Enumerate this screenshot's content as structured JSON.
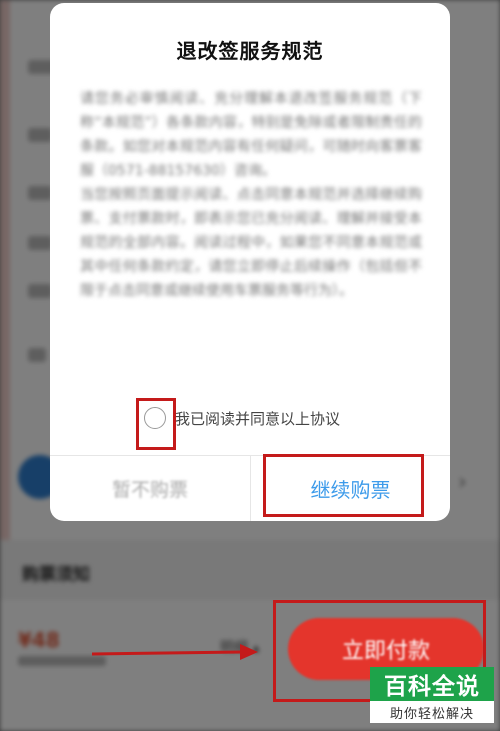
{
  "modal": {
    "title": "退改签服务规范",
    "body_text": "请您务必审慎阅读、充分理解本退改签服务规范（下称“本规范”）各条款内容，特别是免除或者限制责任的条款。如您对本规范内容有任何疑问，可随时向客票客服（0571-88157630）咨询。",
    "body_text_2": "当您按照页面提示阅读、点击同意本规范并选择继续购票、支付票款时，即表示您已充分阅读、理解并接受本规范的全部内容。阅读过程中，如果您不同意本规范或其中任何条款约定，请您立即停止后续操作（包括但不限于点击同意或继续使用车票服务等行为）。",
    "agree_label": "我已阅读并同意以上协议",
    "decline_label": "暂不购票",
    "continue_label": "继续购票"
  },
  "background": {
    "section_title": "购票须知",
    "price": "¥48",
    "detail_label": "明细",
    "pay_button_label": "立即付款"
  },
  "watermark": {
    "logo_title": "百科全说",
    "logo_subtitle": "助你轻松解决"
  },
  "colors": {
    "annotation_red": "#c41a1a",
    "continue_blue": "#3d9bea",
    "pay_red": "#e4352c",
    "logo_green": "#1ea34a"
  }
}
